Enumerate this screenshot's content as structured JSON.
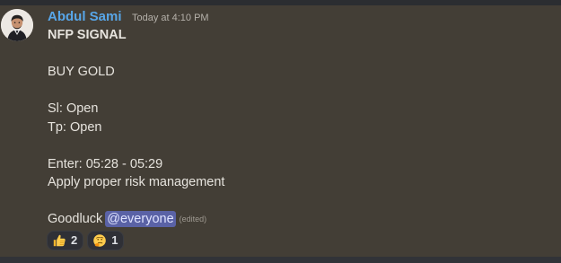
{
  "message": {
    "author": {
      "name": "Abdul Sami",
      "color": "#58a6e8",
      "avatar_icon": "profile-photo"
    },
    "timestamp": "Today at 4:10 PM",
    "lines": {
      "title": "NFP SIGNAL",
      "action": "BUY GOLD",
      "sl": "Sl: Open",
      "tp": "Tp: Open",
      "enter": "Enter: 05:28 - 05:29",
      "risk": "Apply proper risk management",
      "goodluck": "Goodluck",
      "mention": "@everyone",
      "edited": "(edited)"
    },
    "reactions": [
      {
        "emoji_name": "thumbs-up",
        "count": "2"
      },
      {
        "emoji_name": "thinking-face",
        "count": "1"
      }
    ]
  },
  "colors": {
    "background": "#2b2d31",
    "message_background": "#433e36",
    "text": "#e6e3dd",
    "mention_background": "#5a62a6"
  }
}
